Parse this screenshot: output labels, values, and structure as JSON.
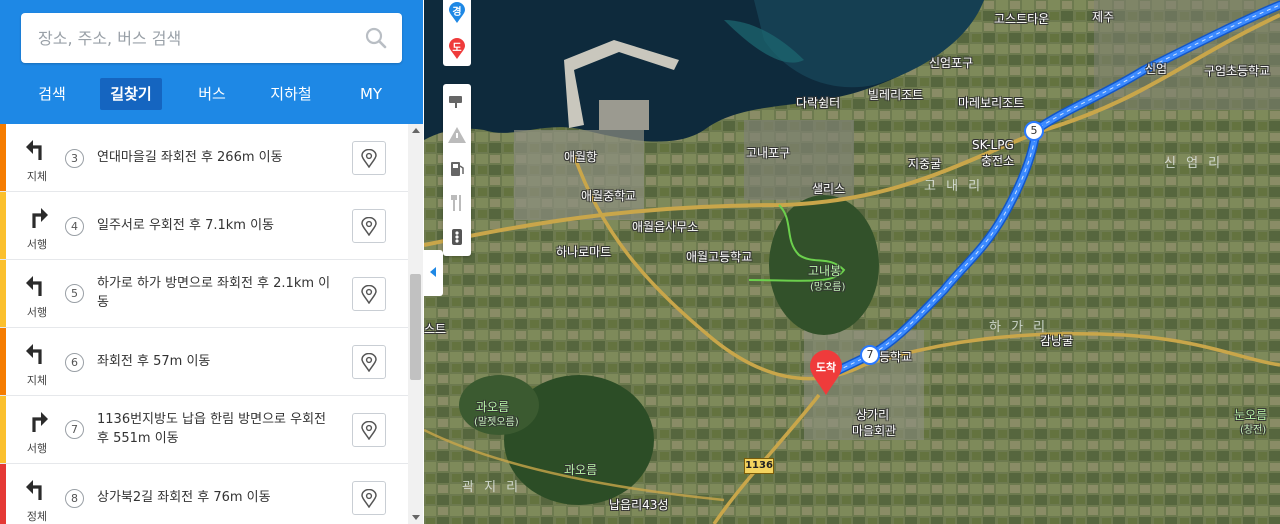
{
  "search": {
    "placeholder": "장소, 주소, 버스 검색"
  },
  "tabs": [
    {
      "label": "검색"
    },
    {
      "label": "길찾기",
      "active": true
    },
    {
      "label": "버스"
    },
    {
      "label": "지하철"
    },
    {
      "label": "MY"
    }
  ],
  "route_steps": [
    {
      "step": "3",
      "turn": "left",
      "traffic": "지체",
      "traffic_color": "#f57c00",
      "instruction": "연대마을길 좌회전 후 266m 이동"
    },
    {
      "step": "4",
      "turn": "right",
      "traffic": "서행",
      "traffic_color": "#fbc02d",
      "instruction": "일주서로 우회전 후 7.1km 이동"
    },
    {
      "step": "5",
      "turn": "left",
      "traffic": "서행",
      "traffic_color": "#fbc02d",
      "instruction": "하가로 하가 방면으로 좌회전 후 2.1km 이동"
    },
    {
      "step": "6",
      "turn": "left",
      "traffic": "지체",
      "traffic_color": "#f57c00",
      "instruction": "좌회전 후 57m 이동"
    },
    {
      "step": "7",
      "turn": "right",
      "traffic": "서행",
      "traffic_color": "#fbc02d",
      "instruction": "1136번지방도 납읍 한림 방면으로 우회전 후 551m 이동"
    },
    {
      "step": "8",
      "turn": "left",
      "traffic": "정체",
      "traffic_color": "#e53935",
      "instruction": "상가북2길 좌회전 후 76m 이동"
    }
  ],
  "map": {
    "top_badges": {
      "via": "경",
      "dest": "도"
    },
    "arrival_label": "도착",
    "route_color": "#2979ff",
    "route_markers": {
      "a": "5",
      "b": "7"
    },
    "road_number": "1136",
    "labels": [
      {
        "text": "고스트타운",
        "kind": "poi"
      },
      {
        "text": "제주",
        "kind": "poi"
      },
      {
        "text": "신엄포구",
        "kind": "poi"
      },
      {
        "text": "애월항",
        "kind": "poi"
      },
      {
        "text": "다락쉼터",
        "kind": "poi"
      },
      {
        "text": "빌레리조트",
        "kind": "poi"
      },
      {
        "text": "마레보리조트",
        "kind": "poi"
      },
      {
        "text": "신엄",
        "kind": "poi"
      },
      {
        "text": "구엄초등학교",
        "kind": "poi"
      },
      {
        "text": "고내포구",
        "kind": "poi"
      },
      {
        "text": "SK-LPG",
        "kind": "poi"
      },
      {
        "text": "충전소",
        "kind": "poi"
      },
      {
        "text": "지중굴",
        "kind": "poi"
      },
      {
        "text": "애월중학교",
        "kind": "poi"
      },
      {
        "text": "샐리스",
        "kind": "poi"
      },
      {
        "text": "고 내 리",
        "kind": "area"
      },
      {
        "text": "신 엄 리",
        "kind": "area"
      },
      {
        "text": "애월읍사무소",
        "kind": "poi"
      },
      {
        "text": "하나로마트",
        "kind": "poi"
      },
      {
        "text": "애월고등학교",
        "kind": "poi"
      },
      {
        "text": "고내봉",
        "kind": "green"
      },
      {
        "text": "(망오름)",
        "kind": "greensmall"
      },
      {
        "text": "하 가 리",
        "kind": "area"
      },
      {
        "text": "감낭굴",
        "kind": "poi"
      },
      {
        "text": "등학교",
        "kind": "poi"
      },
      {
        "text": "과오름",
        "kind": "green"
      },
      {
        "text": "(말젯오름)",
        "kind": "greensmall"
      },
      {
        "text": "상가리",
        "kind": "poi"
      },
      {
        "text": "마을회관",
        "kind": "poi"
      },
      {
        "text": "눈오름",
        "kind": "green"
      },
      {
        "text": "(창전)",
        "kind": "greensmall"
      },
      {
        "text": "과오름",
        "kind": "green"
      },
      {
        "text": "곽 지 리",
        "kind": "area"
      },
      {
        "text": "납읍리43성",
        "kind": "poi"
      },
      {
        "text": "스트",
        "kind": "poi"
      }
    ]
  }
}
